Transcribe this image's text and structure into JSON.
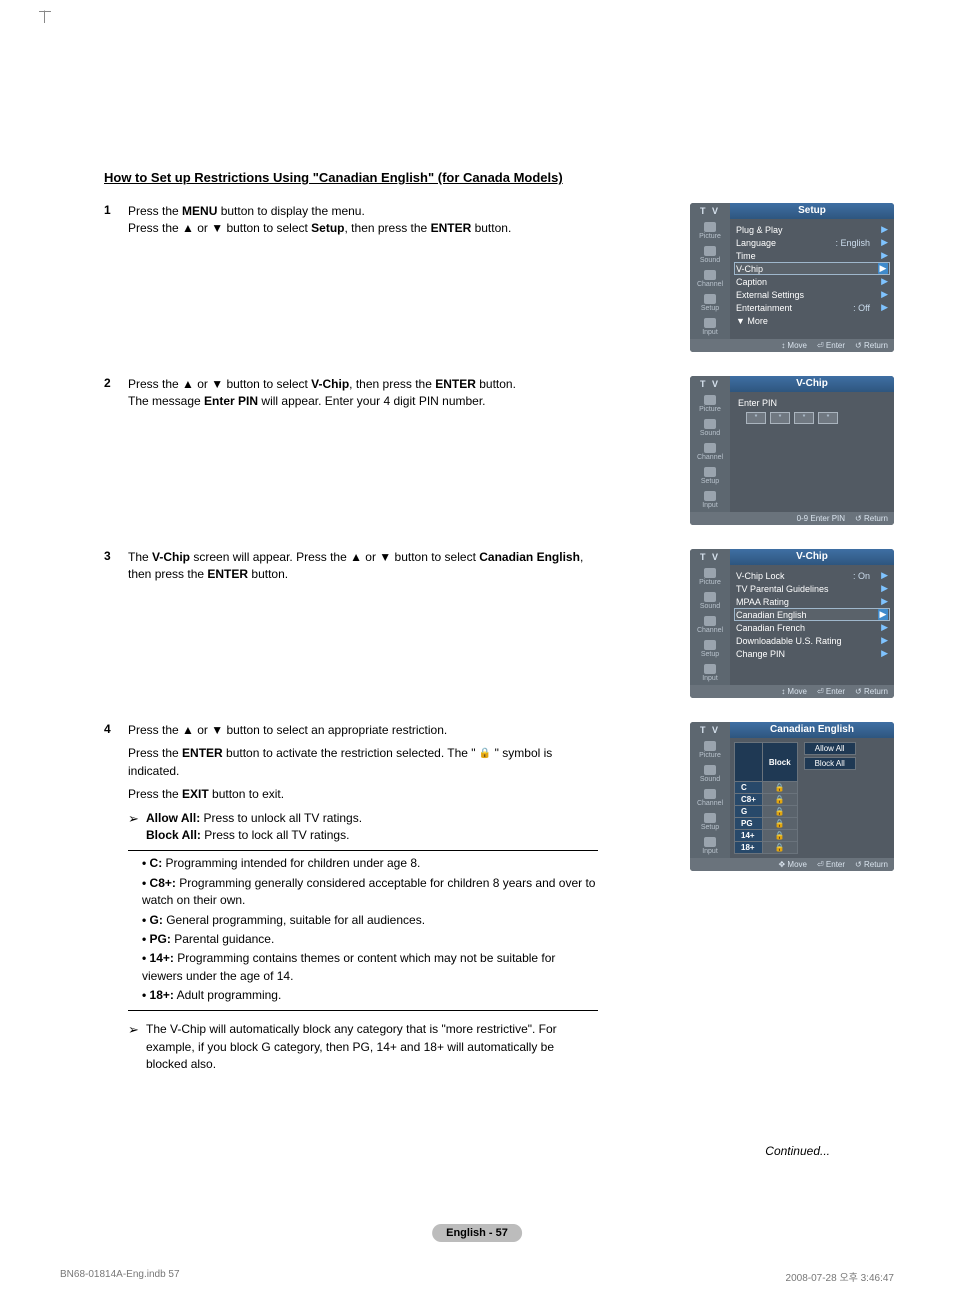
{
  "heading": "How to Set up Restrictions Using \"Canadian English\" (for Canada Models)",
  "steps": {
    "1": {
      "num": "1",
      "l1_a": "Press the ",
      "l1_b": "MENU",
      "l1_c": " button to display the menu.",
      "l2_a": "Press the ▲ or ▼ button to select ",
      "l2_b": "Setup",
      "l2_c": ", then press the ",
      "l2_d": "ENTER",
      "l2_e": " button."
    },
    "2": {
      "num": "2",
      "l1_a": "Press the ▲ or ▼ button to select ",
      "l1_b": "V-Chip",
      "l1_c": ", then press the ",
      "l1_d": "ENTER",
      "l1_e": " button.",
      "l2_a": "The message ",
      "l2_b": "Enter PIN",
      "l2_c": " will appear. Enter your 4 digit PIN number."
    },
    "3": {
      "num": "3",
      "l1_a": "The ",
      "l1_b": "V-Chip",
      "l1_c": " screen will appear. Press the ▲ or ▼ button to select ",
      "l1_d": "Canadian English",
      "l1_e": ", then press the ",
      "l1_f": "ENTER",
      "l1_g": " button."
    },
    "4": {
      "num": "4",
      "l1": "Press the ▲ or ▼ button to select an appropriate restriction.",
      "l2_a": "Press the ",
      "l2_b": "ENTER",
      "l2_c": " button to activate the restriction selected. The \" ",
      "l2_d": " \" symbol is indicated.",
      "l3_a": "Press the ",
      "l3_b": "EXIT",
      "l3_c": " button to exit.",
      "aa_lbl": "Allow All:",
      "aa_txt": " Press to unlock all TV ratings.",
      "ba_lbl": "Block All:",
      "ba_txt": " Press to lock all TV ratings.",
      "defs": {
        "c_lbl": "C:",
        "c_txt": " Programming intended for children under age 8.",
        "c8_lbl": "C8+:",
        "c8_txt": " Programming generally considered acceptable for children 8 years and over to watch on their own.",
        "g_lbl": "G:",
        "g_txt": " General programming, suitable for all audiences.",
        "pg_lbl": "PG:",
        "pg_txt": " Parental guidance.",
        "p14_lbl": "14+:",
        "p14_txt": " Programming contains themes or content which may not be suitable for viewers under the age of 14.",
        "p18_lbl": "18+:",
        "p18_txt": " Adult programming."
      },
      "auto_note": "The V-Chip will automatically block any category that is \"more restrictive\". For example, if you block G category, then PG, 14+ and 18+ will automatically be blocked also."
    }
  },
  "osd": {
    "tv": "T V",
    "side": {
      "picture": "Picture",
      "sound": "Sound",
      "channel": "Channel",
      "setup": "Setup",
      "input": "Input"
    },
    "setup": {
      "title": "Setup",
      "rows": {
        "plug": "Plug & Play",
        "lang": "Language",
        "lang_v": ": English",
        "time": "Time",
        "vchip": "V-Chip",
        "caption": "Caption",
        "ext": "External Settings",
        "ent": "Entertainment",
        "ent_v": ": Off",
        "more": "▼ More"
      },
      "footer": {
        "move": "Move",
        "enter": "Enter",
        "return": "Return"
      }
    },
    "pin": {
      "title": "V-Chip",
      "prompt": "Enter PIN",
      "stars": [
        "*",
        "*",
        "*",
        "*"
      ],
      "footer": {
        "epin": "Enter PIN",
        "return": "Return"
      }
    },
    "vchip": {
      "title": "V-Chip",
      "rows": {
        "lock": "V-Chip Lock",
        "lock_v": ": On",
        "tpg": "TV Parental Guidelines",
        "mpaa": "MPAA Rating",
        "ce": "Canadian English",
        "cf": "Canadian French",
        "dus": "Downloadable U.S. Rating",
        "cpin": "Change PIN"
      },
      "footer": {
        "move": "Move",
        "enter": "Enter",
        "return": "Return"
      }
    },
    "ce": {
      "title": "Canadian English",
      "block": "Block",
      "allow": "Allow All",
      "blockall": "Block All",
      "ratings": [
        "C",
        "C8+",
        "G",
        "PG",
        "14+",
        "18+"
      ],
      "lock": "🔒",
      "footer": {
        "move": "Move",
        "enter": "Enter",
        "return": "Return"
      }
    }
  },
  "continued": "Continued...",
  "page_label": "English - 57",
  "footer": {
    "left": "BN68-01814A-Eng.indb   57",
    "right": "2008-07-28   오후 3:46:47"
  },
  "glyphs": {
    "pointer": "➢",
    "lock": "🔒",
    "updown": "↕",
    "enter_icon": "⏎",
    "return_icon": "↺",
    "nav": "✥",
    "zero": "0-9"
  }
}
